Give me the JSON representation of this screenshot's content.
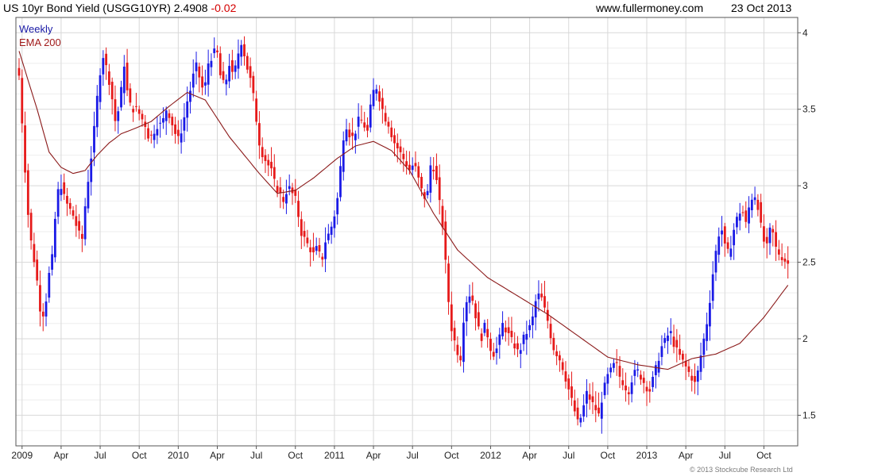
{
  "header": {
    "title_main": "US 10yr Bond Yield (USGG10YR) 2.4908",
    "title_change": "-0.02",
    "site": "www.fullermoney.com",
    "date": "23 Oct 2013"
  },
  "legend": {
    "weekly_label": "Weekly",
    "ema_label": "EMA 200"
  },
  "copyright": "© 2013 Stockcube Research Ltd",
  "colors": {
    "up": "#1a1ae6",
    "down": "#e61a1a",
    "ema": "#8b1a1a",
    "grid": "#d8d8d8",
    "frame": "#555555"
  },
  "chart_data": {
    "type": "candlestick",
    "title": "US 10yr Bond Yield (USGG10YR)",
    "period": "weekly",
    "last_value": 2.4908,
    "change": -0.02,
    "ylim": [
      1.3,
      4.1
    ],
    "yticks": [
      1.5,
      2,
      2.5,
      3,
      3.5,
      4
    ],
    "grid": true,
    "legend_position": "top-left",
    "x_tick_labels": [
      "2009",
      "Apr",
      "Jul",
      "Oct",
      "2010",
      "Apr",
      "Jul",
      "Oct",
      "2011",
      "Apr",
      "Jul",
      "Oct",
      "2012",
      "Apr",
      "Jul",
      "Oct",
      "2013",
      "Apr",
      "Jul",
      "Oct"
    ],
    "x_tick_week_index": [
      1,
      14,
      27,
      40,
      53,
      66,
      79,
      92,
      105,
      118,
      131,
      144,
      157,
      170,
      183,
      196,
      209,
      222,
      235,
      248
    ],
    "series": [
      {
        "name": "Weekly",
        "kind": "close",
        "values": [
          3.72,
          3.3,
          2.85,
          2.6,
          2.45,
          2.2,
          2.15,
          2.4,
          2.55,
          2.95,
          3.0,
          2.9,
          2.85,
          2.8,
          2.7,
          2.65,
          2.95,
          3.15,
          3.4,
          3.7,
          3.85,
          3.75,
          3.6,
          3.4,
          3.55,
          3.8,
          3.55,
          3.5,
          3.5,
          3.45,
          3.4,
          3.3,
          3.35,
          3.4,
          3.4,
          3.5,
          3.45,
          3.35,
          3.3,
          3.4,
          3.55,
          3.65,
          3.8,
          3.7,
          3.6,
          3.8,
          3.85,
          3.9,
          3.7,
          3.65,
          3.8,
          3.7,
          3.85,
          3.95,
          3.8,
          3.7,
          3.55,
          3.3,
          3.2,
          3.15,
          3.1,
          3.0,
          2.95,
          2.9,
          3.0,
          2.95,
          2.9,
          2.7,
          2.65,
          2.6,
          2.55,
          2.6,
          2.5,
          2.65,
          2.7,
          2.8,
          2.95,
          3.3,
          3.4,
          3.3,
          3.35,
          3.45,
          3.4,
          3.35,
          3.6,
          3.65,
          3.55,
          3.45,
          3.4,
          3.3,
          3.25,
          3.2,
          3.15,
          3.1,
          3.15,
          3.05,
          2.95,
          2.9,
          3.15,
          3.1,
          2.9,
          2.7,
          2.3,
          2.05,
          1.95,
          1.85,
          2.2,
          2.3,
          2.25,
          2.1,
          2.0,
          2.1,
          1.95,
          1.9,
          1.95,
          2.1,
          2.05,
          2.0,
          1.95,
          1.9,
          2.0,
          2.05,
          2.1,
          2.25,
          2.3,
          2.2,
          2.1,
          1.95,
          1.9,
          1.85,
          1.75,
          1.65,
          1.55,
          1.45,
          1.5,
          1.65,
          1.6,
          1.55,
          1.5,
          1.65,
          1.75,
          1.8,
          1.85,
          1.75,
          1.7,
          1.65,
          1.75,
          1.8,
          1.75,
          1.7,
          1.65,
          1.75,
          1.85,
          1.95,
          2.0,
          2.05,
          1.95,
          1.9,
          1.85,
          1.8,
          1.75,
          1.7,
          1.85,
          2.0,
          2.15,
          2.4,
          2.6,
          2.75,
          2.6,
          2.55,
          2.7,
          2.8,
          2.85,
          2.75,
          2.9,
          2.95,
          2.85,
          2.65,
          2.6,
          2.75,
          2.6,
          2.55,
          2.52,
          2.49
        ]
      },
      {
        "name": "EMA 200",
        "kind": "line",
        "anchor_index": [
          0,
          6,
          10,
          14,
          18,
          22,
          26,
          30,
          34,
          38,
          44,
          50,
          56,
          62,
          66,
          70,
          75,
          80,
          86,
          92,
          98,
          106,
          112,
          118,
          124,
          130,
          138,
          146,
          156,
          166,
          176,
          186,
          196,
          206,
          216,
          224,
          232,
          240,
          248,
          256
        ],
        "anchor_value": [
          3.88,
          3.5,
          3.22,
          3.12,
          3.08,
          3.1,
          3.2,
          3.28,
          3.34,
          3.37,
          3.42,
          3.52,
          3.61,
          3.56,
          3.44,
          3.32,
          3.2,
          3.08,
          2.95,
          2.97,
          3.05,
          3.18,
          3.26,
          3.29,
          3.23,
          3.1,
          2.82,
          2.58,
          2.4,
          2.28,
          2.16,
          2.02,
          1.88,
          1.83,
          1.8,
          1.87,
          1.9,
          1.97,
          2.14,
          2.35
        ]
      }
    ]
  }
}
